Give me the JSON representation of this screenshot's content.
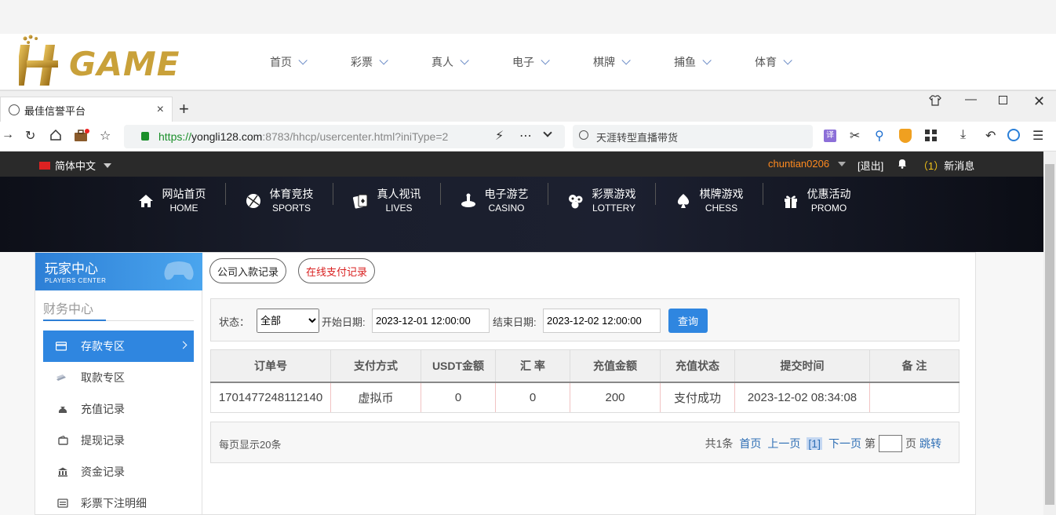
{
  "site": {
    "logo_text": "GAME",
    "nav": [
      "首页",
      "彩票",
      "真人",
      "电子",
      "棋牌",
      "捕鱼",
      "体育"
    ]
  },
  "browser": {
    "tab_title": "最佳信誉平台",
    "url_scheme": "https://",
    "url_host": "yongli128.com",
    "url_rest": ":8783/hhcp/usercenter.html?iniType=2",
    "search_text": "天涯转型直播带货"
  },
  "topbar": {
    "language": "简体中文",
    "username": "chuntian0206",
    "logout": "[退出]",
    "msg_count": "（1）",
    "msg_label": "新消息"
  },
  "main_nav": [
    {
      "cn": "网站首页",
      "en": "HOME",
      "icon": "home-icon"
    },
    {
      "cn": "体育竞技",
      "en": "SPORTS",
      "icon": "ball-icon"
    },
    {
      "cn": "真人视讯",
      "en": "LIVES",
      "icon": "cards-icon"
    },
    {
      "cn": "电子游艺",
      "en": "CASINO",
      "icon": "slot-icon"
    },
    {
      "cn": "彩票游戏",
      "en": "LOTTERY",
      "icon": "lottery-balls-icon"
    },
    {
      "cn": "棋牌游戏",
      "en": "CHESS",
      "icon": "spade-icon"
    },
    {
      "cn": "优惠活动",
      "en": "PROMO",
      "icon": "gift-icon"
    }
  ],
  "sidebar": {
    "title_cn": "玩家中心",
    "title_en": "PLAYERS CENTER",
    "section": "财务中心",
    "items": [
      "存款专区",
      "取款专区",
      "充值记录",
      "提现记录",
      "资金记录",
      "彩票下注明细"
    ]
  },
  "record_tabs": [
    "公司入款记录",
    "在线支付记录"
  ],
  "filter": {
    "status_label": "状态：",
    "status_value": "全部",
    "start_label": "开始日期:",
    "start_value": "2023-12-01 12:00:00",
    "end_label": "结束日期:",
    "end_value": "2023-12-02 12:00:00",
    "query": "查询"
  },
  "table": {
    "headers": [
      "订单号",
      "支付方式",
      "USDT金额",
      "汇 率",
      "充值金额",
      "充值状态",
      "提交时间",
      "备 注"
    ],
    "rows": [
      [
        "1701477248112140",
        "虚拟币",
        "0",
        "0",
        "200",
        "支付成功",
        "2023-12-02 08:34:08",
        ""
      ]
    ]
  },
  "pager": {
    "per_page": "每页显示20条",
    "total": "共1条",
    "first": "首页",
    "prev": "上一页",
    "current": "[1]",
    "next": "下一页",
    "page_prefix": "第",
    "page_suffix": "页",
    "jump": "跳转"
  },
  "colors": {
    "accent": "#2f86e0",
    "username": "#ff8a1f",
    "online_tab": "#d92020",
    "logo_gold": "#c9a13a"
  }
}
